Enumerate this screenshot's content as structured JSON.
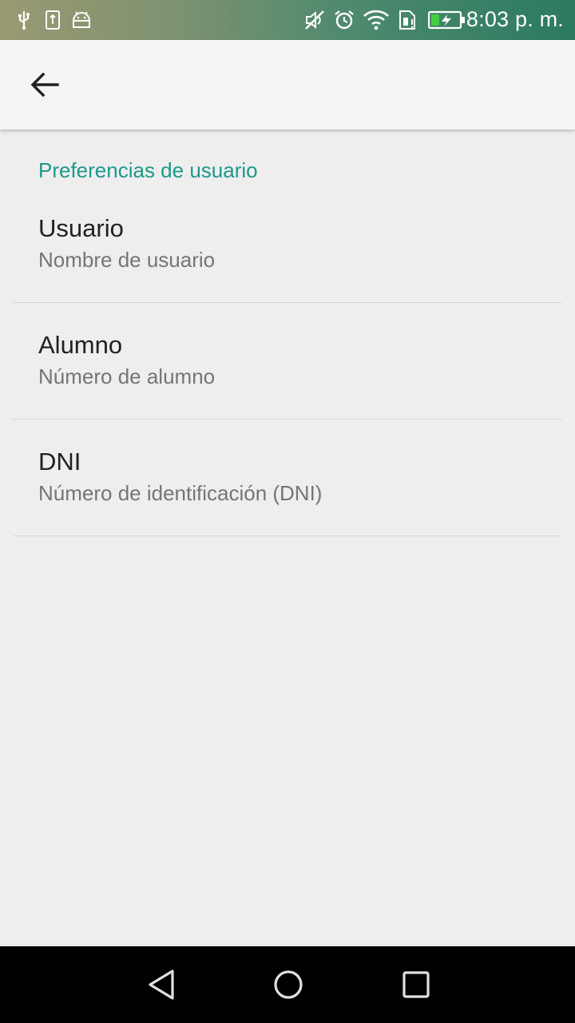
{
  "status_bar": {
    "time": "8:03 p. m.",
    "left_icons": [
      "usb-icon",
      "sd-card-icon",
      "android-debug-icon"
    ],
    "right_icons": [
      "mute-icon",
      "alarm-icon",
      "wifi-icon",
      "sim-icon",
      "battery-charging-icon"
    ]
  },
  "app_bar": {
    "back_icon": "arrow-back-icon"
  },
  "preferences": {
    "section_title": "Preferencias de usuario",
    "items": [
      {
        "title": "Usuario",
        "summary": "Nombre de usuario"
      },
      {
        "title": "Alumno",
        "summary": "Número de alumno"
      },
      {
        "title": "DNI",
        "summary": "Número de identificación (DNI)"
      }
    ]
  },
  "nav_bar": {
    "icons": [
      "nav-back-icon",
      "nav-home-icon",
      "nav-recents-icon"
    ]
  },
  "colors": {
    "accent": "#1a9a8a",
    "background": "#eeeeee",
    "app_bar": "#f5f5f5",
    "title_text": "#212121",
    "summary_text": "#757575"
  }
}
